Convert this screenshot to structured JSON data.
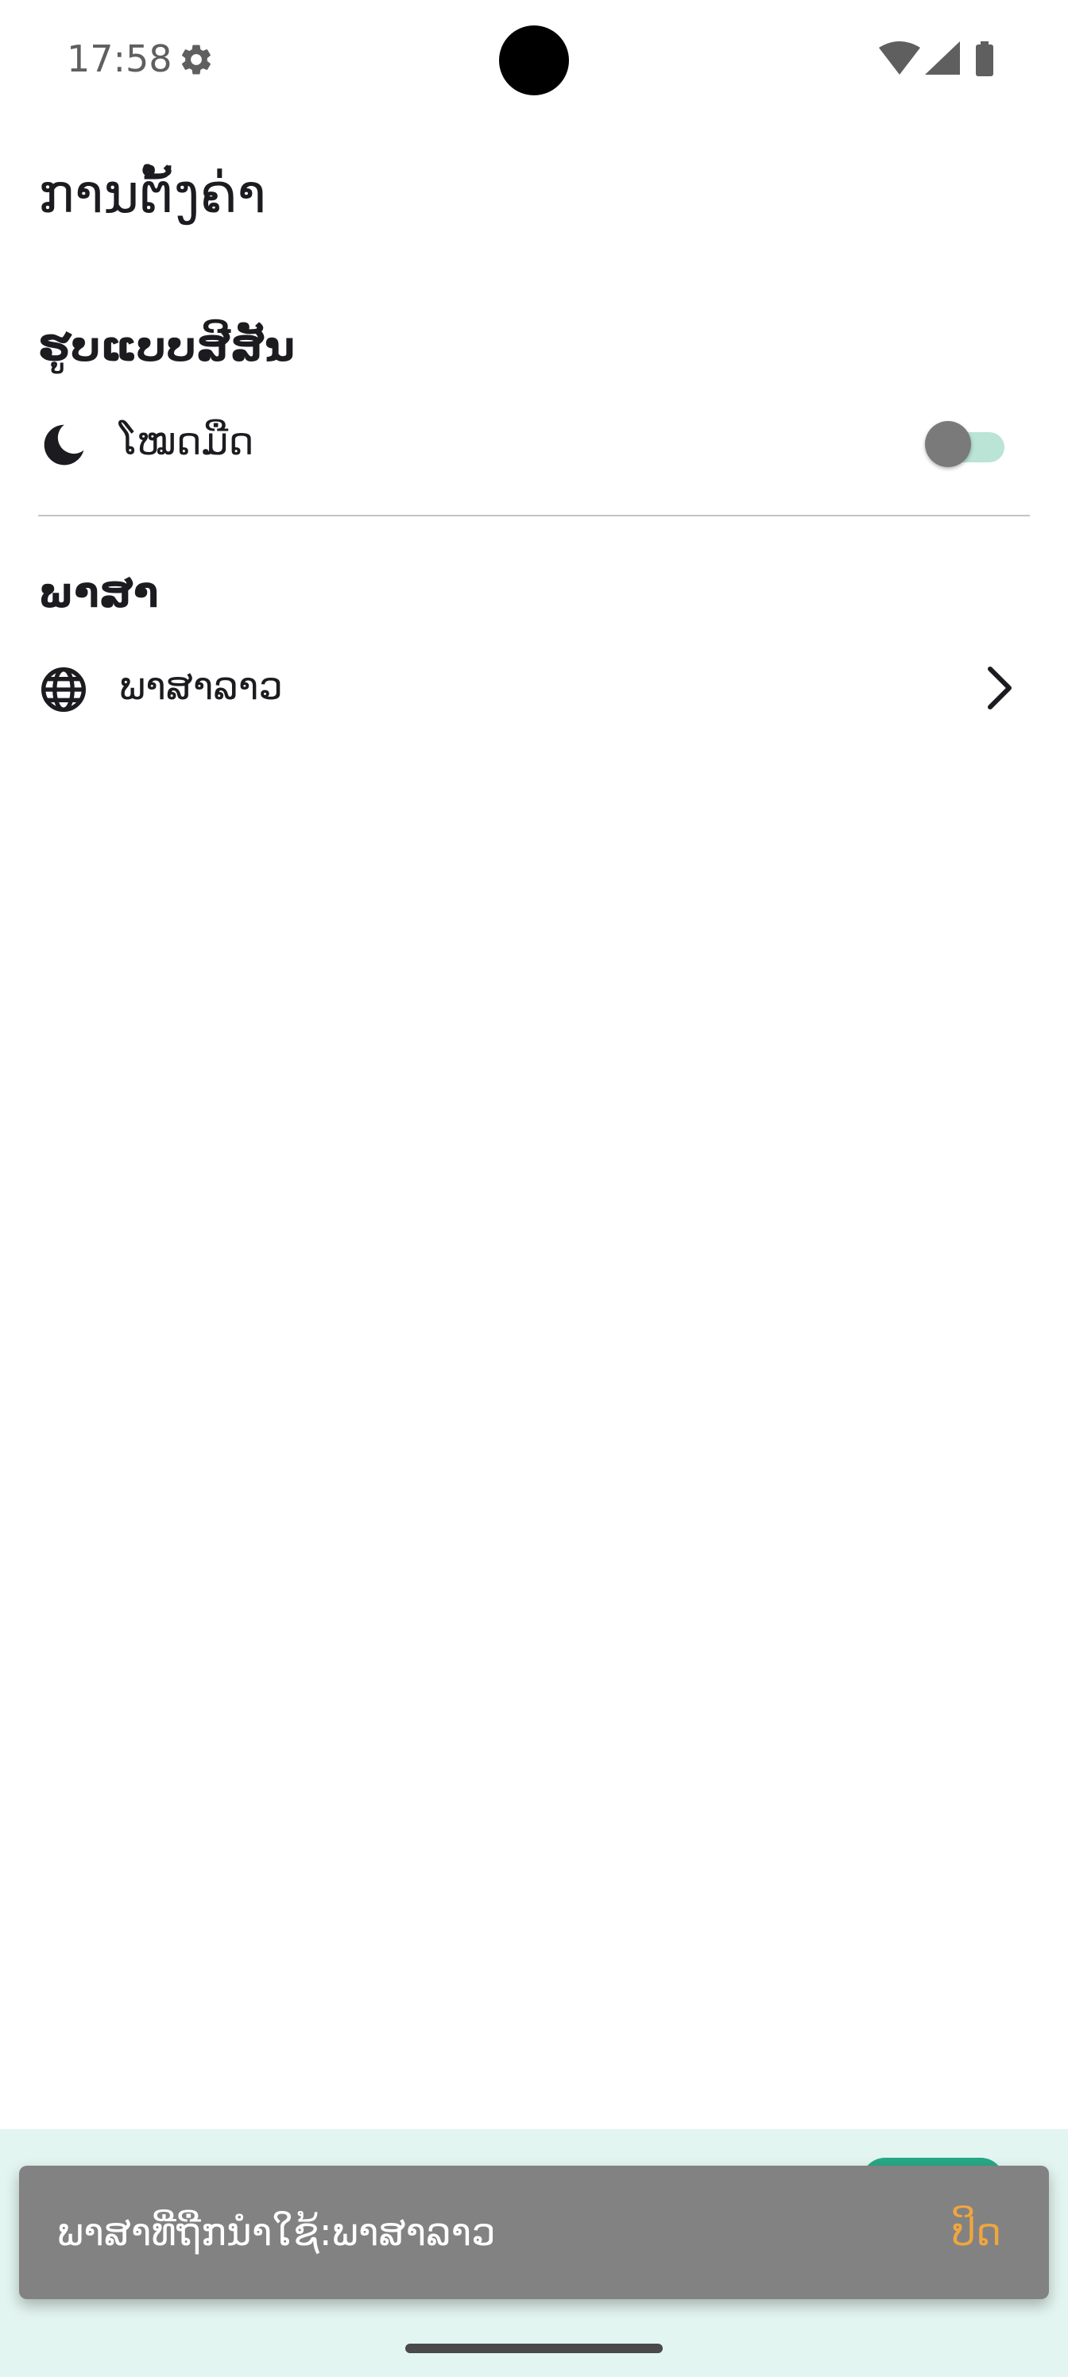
{
  "status_bar": {
    "time": "17:58",
    "icons": [
      "settings-gear-icon",
      "wifi-icon",
      "signal-icon",
      "battery-icon"
    ]
  },
  "page": {
    "title": "ການຕັ້ງຄ່າ"
  },
  "theme_section": {
    "title": "ຮູບແບບສີສັນ",
    "dark_mode": {
      "icon": "moon-icon",
      "label": "ໂໝດມືດ",
      "enabled": false
    }
  },
  "language_section": {
    "title": "ພາສາ",
    "current_language": {
      "icon": "globe-icon",
      "label": "ພາສາລາວ",
      "action_icon": "chevron-right-icon"
    }
  },
  "snackbar": {
    "message": "ພາສາທີ່ຖືກນຳໃຊ້:ພາສາລາວ",
    "action": "ປິດ"
  },
  "colors": {
    "accent": "#27a886",
    "toggle_track_off": "#b9e4d6",
    "snackbar_bg": "#828282",
    "snackbar_action": "#f0a63e",
    "bottom_band": "#e3f5f0"
  }
}
